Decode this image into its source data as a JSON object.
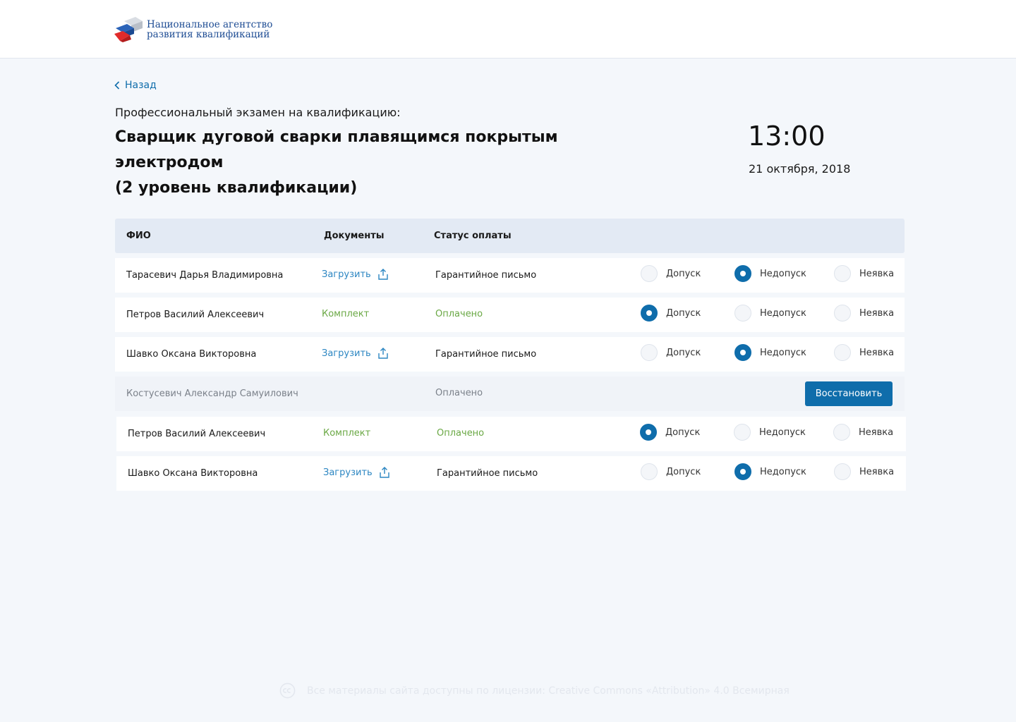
{
  "header": {
    "logo_line1": "Национальное агентство",
    "logo_line2": "развития квалификаций"
  },
  "nav": {
    "back_label": "Назад"
  },
  "exam": {
    "subtitle": "Профессиональный экзамен на квалификацию:",
    "title_line1": "Сварщик дуговой сварки плавящимся покрытым электродом",
    "title_line2": "(2 уровень квалификации)",
    "time": "13:00",
    "date": "21 октября, 2018"
  },
  "table": {
    "columns": {
      "name": "ФИО",
      "documents": "Документы",
      "payment": "Статус оплаты"
    },
    "options": {
      "admit": "Допуск",
      "deny": "Недопуск",
      "absent": "Неявка"
    },
    "restore_label": "Восстановить",
    "rows": [
      {
        "name": "Тарасевич Дарья Владимировна",
        "documents": "Загрузить",
        "payment": "Гарантийное письмо",
        "status": "deny"
      },
      {
        "name": "Петров Василий Алексеевич",
        "documents": "Комплект",
        "payment": "Оплачено",
        "status": "admit"
      },
      {
        "name": "Шавко Оксана Викторовна",
        "documents": "Загрузить",
        "payment": "Гарантийное письмо",
        "status": "deny"
      },
      {
        "name": "Костусевич Александр Самуилович",
        "documents": "",
        "payment": "Оплачено",
        "status": "removed"
      },
      {
        "name": "Петров Василий Алексеевич",
        "documents": "Комплект",
        "payment": "Оплачено",
        "status": "admit"
      },
      {
        "name": "Шавко Оксана Викторовна",
        "documents": "Загрузить",
        "payment": "Гарантийное письмо",
        "status": "deny"
      }
    ]
  },
  "footer": {
    "license_text": "Все материалы сайта доступны по лицензии: Creative Commons «Attribution» 4.0 Всемирная"
  },
  "colors": {
    "accent": "#0f6dab",
    "link": "#2c86c2",
    "paid": "#6aa844",
    "header_row": "#e3eaf4"
  }
}
